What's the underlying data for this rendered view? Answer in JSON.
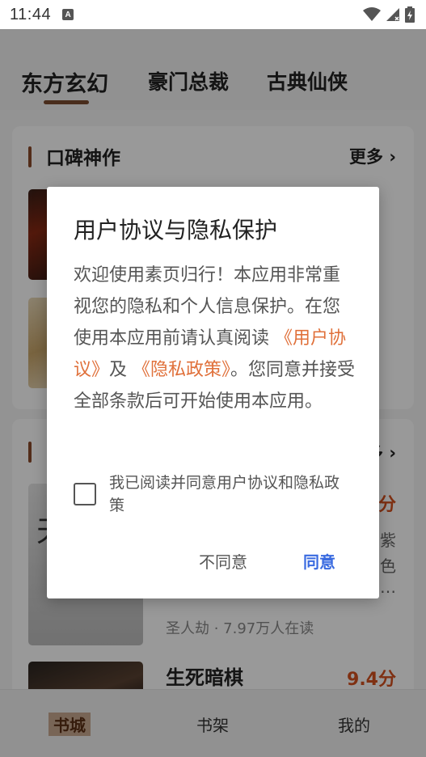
{
  "status_bar": {
    "time": "11:44",
    "notification_icon": "A"
  },
  "tabs": [
    {
      "label": "东方玄幻"
    },
    {
      "label": "豪门总裁"
    },
    {
      "label": "古典仙侠"
    }
  ],
  "sections": [
    {
      "title": "口碑神作",
      "more": "更多"
    },
    {
      "title": "",
      "more": "多"
    }
  ],
  "books": {
    "cover3_text": "天",
    "score_1": "分",
    "side_1": "紫",
    "side_2": "色",
    "side_3": "…",
    "meta": "圣人劫 · 7.97万人在读",
    "title_2": "生死暗棋",
    "score_2": "9.4分"
  },
  "bottom_nav": [
    {
      "label": "书城"
    },
    {
      "label": "书架"
    },
    {
      "label": "我的"
    }
  ],
  "dialog": {
    "title": "用户协议与隐私保护",
    "body_part1": "欢迎使用素页归行！本应用非常重视您的隐私和个人信息保护。在您使用本应用前请认真阅读",
    "link_user_agreement": "《用户协议》",
    "conjunction": "及",
    "link_privacy_policy": "《隐私政策》",
    "body_part2": "。您同意并接受全部条款后可开始使用本应用。",
    "checkbox_label": "我已阅读并同意用户协议和隐私政策",
    "disagree_label": "不同意",
    "agree_label": "同意"
  },
  "colors": {
    "accent_brown": "#7a4b30",
    "link_orange": "#e0703a",
    "agree_blue": "#3a6be0",
    "score_red": "#d4501f"
  }
}
